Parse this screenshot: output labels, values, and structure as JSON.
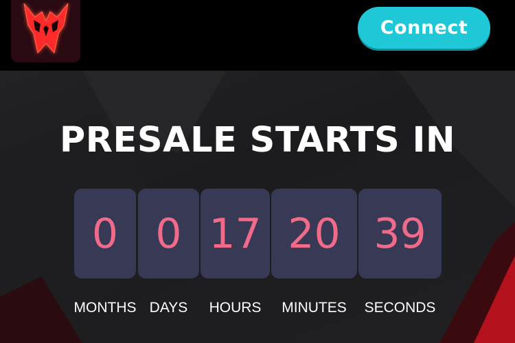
{
  "header": {
    "logo_icon": "red-wolf-mask-logo",
    "connect_label": "Connect"
  },
  "hero": {
    "title": "PRESALE STARTS IN"
  },
  "countdown": {
    "units": [
      {
        "value": "0",
        "label": "MONTHS"
      },
      {
        "value": "0",
        "label": "DAYS"
      },
      {
        "value": "17",
        "label": "HOURS"
      },
      {
        "value": "20",
        "label": "MINUTES"
      },
      {
        "value": "39",
        "label": "SECONDS"
      }
    ]
  },
  "colors": {
    "accent_button": "#1ec8d6",
    "tile_background": "#373955",
    "digit_color": "#f26a8a",
    "logo_red": "#ff2a2a"
  }
}
